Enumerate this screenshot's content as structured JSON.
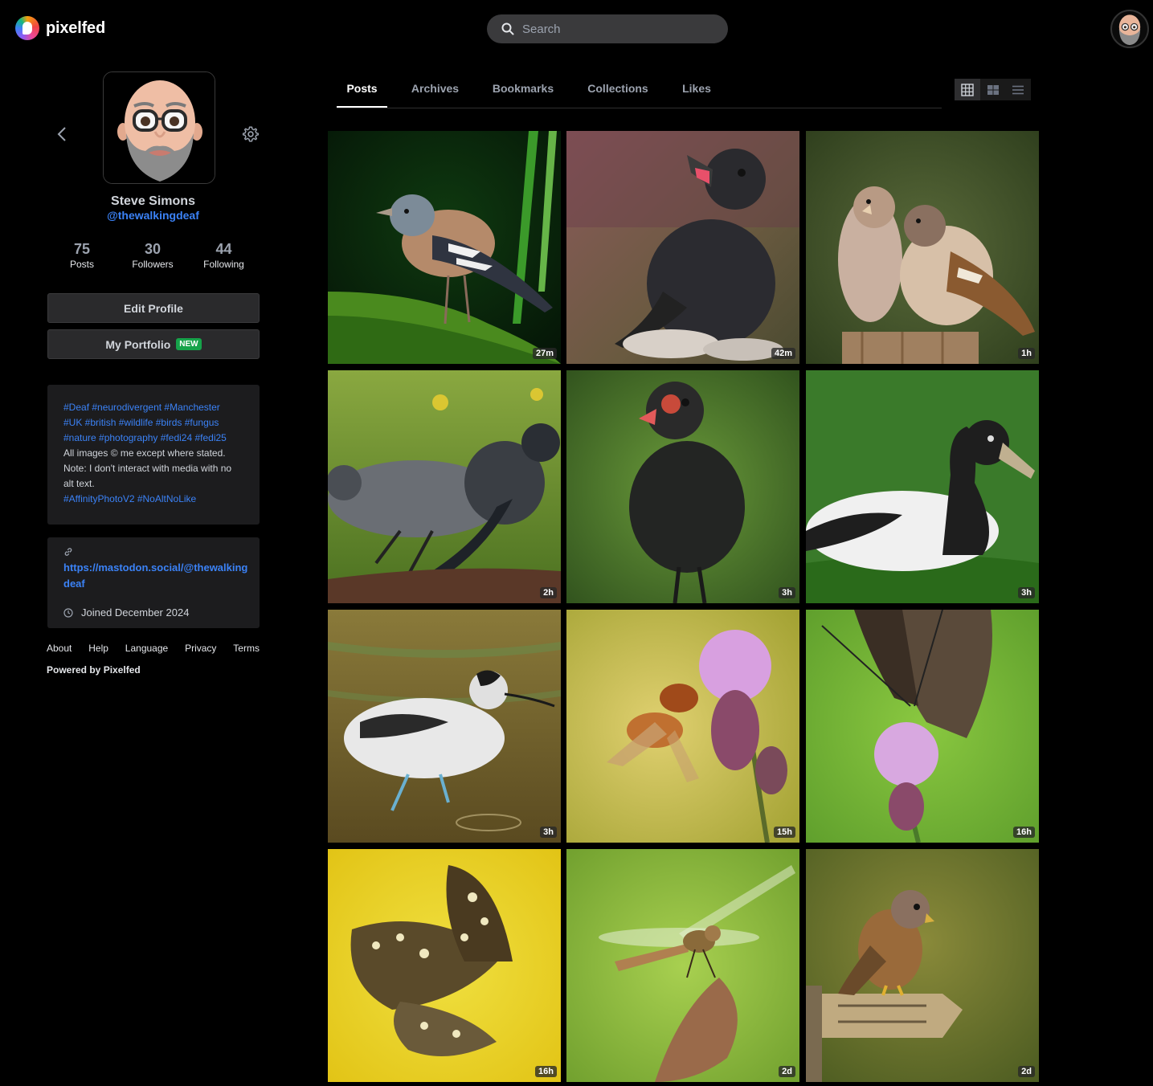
{
  "app": {
    "name": "pixelfed"
  },
  "search": {
    "placeholder": "Search"
  },
  "profile": {
    "display_name": "Steve Simons",
    "handle": "@thewalkingdeaf",
    "stats": [
      {
        "value": "75",
        "label": "Posts"
      },
      {
        "value": "30",
        "label": "Followers"
      },
      {
        "value": "44",
        "label": "Following"
      }
    ],
    "edit_button": "Edit Profile",
    "portfolio_button": "My Portfolio",
    "portfolio_badge": "NEW",
    "bio": {
      "line1": "#Deaf #neurodivergent #Manchester",
      "line2": "#UK #british #wildlife #birds #fungus",
      "line3": "#nature #photography #fedi24 #fedi25",
      "line4": "All images © me except where stated.",
      "line5": "Note: I don't interact with media with no",
      "line6": "alt text.",
      "line7": "#AffinityPhotoV2 #NoAltNoLike"
    },
    "website": "https://mastodon.social/@thewalkingdeaf",
    "joined": "Joined December 2024"
  },
  "footer": {
    "links": [
      "About",
      "Help",
      "Language",
      "Privacy",
      "Terms"
    ],
    "powered_by": "Powered by Pixelfed"
  },
  "tabs": [
    "Posts",
    "Archives",
    "Bookmarks",
    "Collections",
    "Likes"
  ],
  "active_tab": "Posts",
  "view_modes": [
    "grid-3-icon",
    "grid-2-icon",
    "list-icon"
  ],
  "posts": [
    {
      "subject": "chaffinch",
      "time": "27m"
    },
    {
      "subject": "juvenile-crow",
      "time": "42m"
    },
    {
      "subject": "sparrows",
      "time": "1h"
    },
    {
      "subject": "jackdaws",
      "time": "2h"
    },
    {
      "subject": "coot-chick",
      "time": "3h"
    },
    {
      "subject": "magpie-goose",
      "time": "3h"
    },
    {
      "subject": "avocet",
      "time": "3h"
    },
    {
      "subject": "hoverfly-thistle",
      "time": "15h"
    },
    {
      "subject": "peacock-butterfly",
      "time": "16h"
    },
    {
      "subject": "speckled-wood",
      "time": "16h"
    },
    {
      "subject": "dragonfly",
      "time": "2d"
    },
    {
      "subject": "kestrel",
      "time": "2d"
    }
  ],
  "colors": {
    "accent": "#3b82f6",
    "background": "#000000",
    "card": "#1c1c1e",
    "new_badge": "#16a34a"
  }
}
